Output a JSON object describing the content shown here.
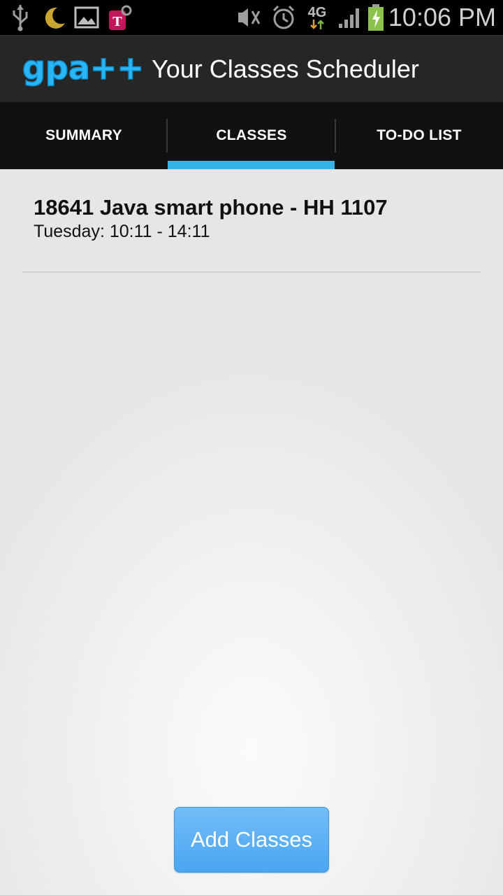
{
  "status_bar": {
    "time": "10:06 PM",
    "network": "4G",
    "icons": [
      "usb-icon",
      "night-mode-icon",
      "gallery-icon",
      "carrier-t-icon",
      "mute-icon",
      "alarm-icon",
      "4g-icon",
      "signal-icon",
      "battery-charging-icon"
    ]
  },
  "header": {
    "logo_text": "gpa++",
    "title": "Your Classes Scheduler"
  },
  "tabs": [
    {
      "label": "SUMMARY",
      "selected": false
    },
    {
      "label": "CLASSES",
      "selected": true
    },
    {
      "label": "TO-DO LIST",
      "selected": false
    }
  ],
  "classes": [
    {
      "title": "18641 Java smart phone - HH 1107",
      "schedule": "Tuesday: 10:11 - 14:11"
    }
  ],
  "add_button_label": "Add Classes",
  "colors": {
    "accent": "#33b5e5",
    "button": "#4aa5f2",
    "logo": "#29b6f6"
  }
}
